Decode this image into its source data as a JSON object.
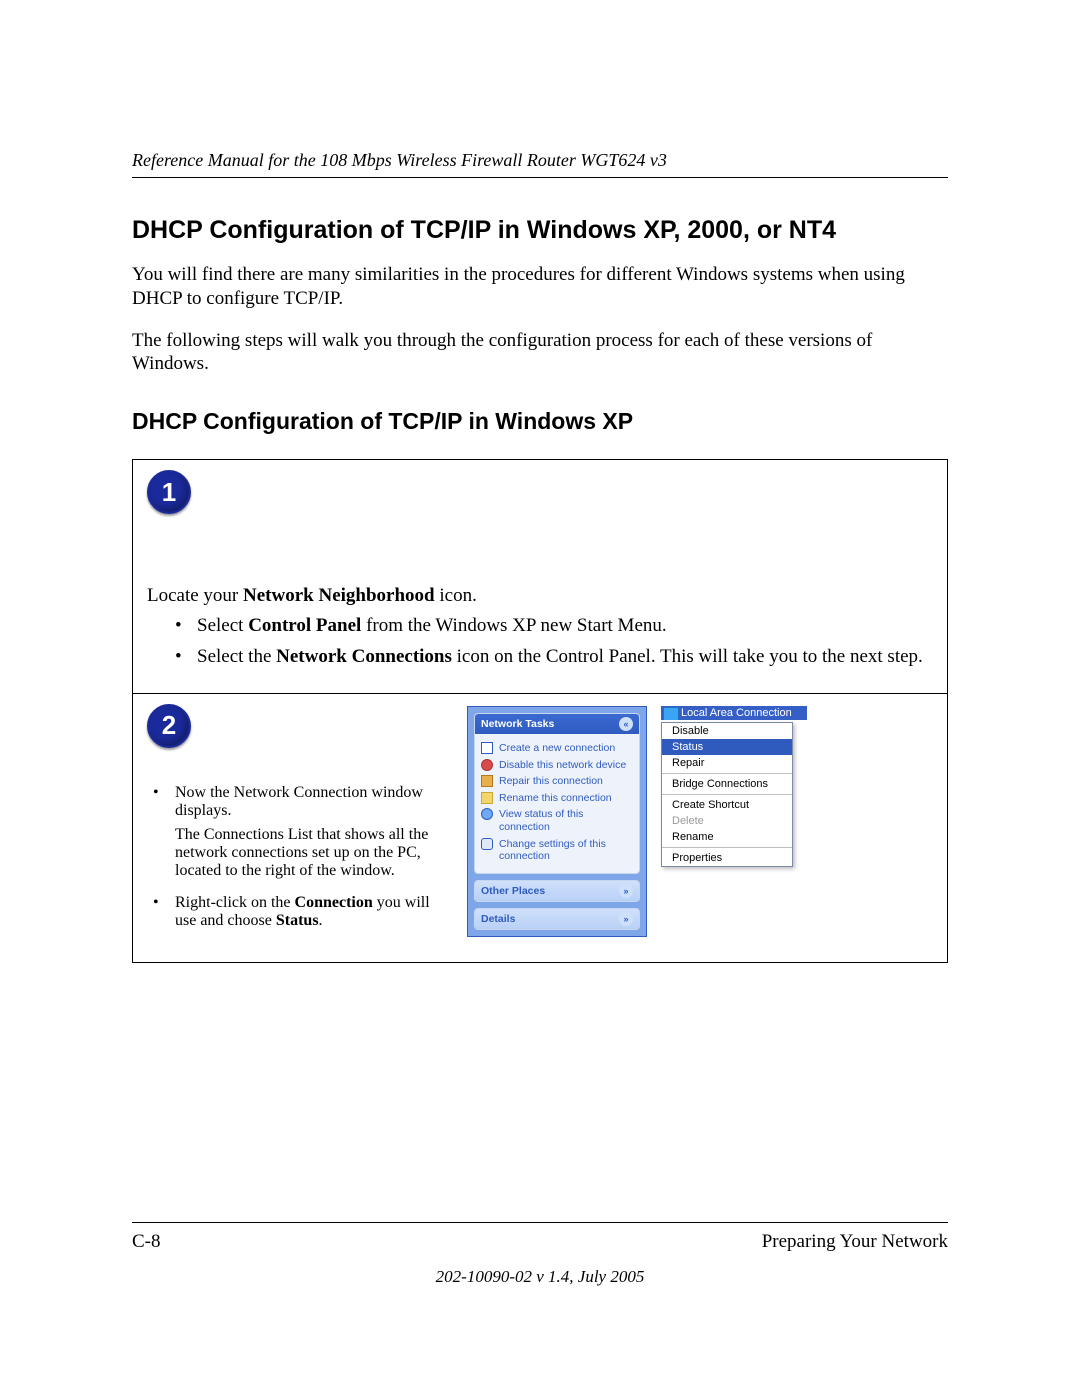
{
  "header": {
    "running": "Reference Manual for the 108 Mbps Wireless Firewall Router WGT624 v3"
  },
  "h1": "DHCP Configuration of TCP/IP in Windows XP, 2000, or NT4",
  "intro1": "You will find there are many similarities in the procedures for different Windows systems when using DHCP to configure TCP/IP.",
  "intro2": "The following steps will walk you through the configuration process for each of these versions of Windows.",
  "h2": "DHCP Configuration of TCP/IP in Windows XP",
  "step1": {
    "badge": "1",
    "lead_pre": "Locate your ",
    "lead_bold": "Network Neighborhood",
    "lead_post": " icon.",
    "b1_pre": "Select ",
    "b1_bold": "Control Panel",
    "b1_post": " from the Windows XP new Start Menu.",
    "b2_pre": "Select the ",
    "b2_bold": "Network Connections",
    "b2_post": " icon on the Control Panel.  This will take you to the next step."
  },
  "step2": {
    "badge": "2",
    "p1": "Now the Network Connection window displays.",
    "p2": "The Connections List that shows all the network connections set up on the PC, located to the right of the window.",
    "p3_pre": "Right-click on the ",
    "p3_bold1": "Connection",
    "p3_mid": " you will use and choose ",
    "p3_bold2": "Status",
    "p3_post": "."
  },
  "xp": {
    "tasks_title": "Network Tasks",
    "tasks": [
      "Create a new connection",
      "Disable this network device",
      "Repair this connection",
      "Rename this connection",
      "View status of this connection",
      "Change settings of this connection"
    ],
    "other_places": "Other Places",
    "details": "Details",
    "connection": "Local Area Connection",
    "ctx": [
      "Disable",
      "Status",
      "Repair",
      "Bridge Connections",
      "Create Shortcut",
      "Delete",
      "Rename",
      "Properties"
    ]
  },
  "footer": {
    "page": "C-8",
    "section": "Preparing Your Network",
    "docno": "202-10090-02 v 1.4, July 2005"
  }
}
